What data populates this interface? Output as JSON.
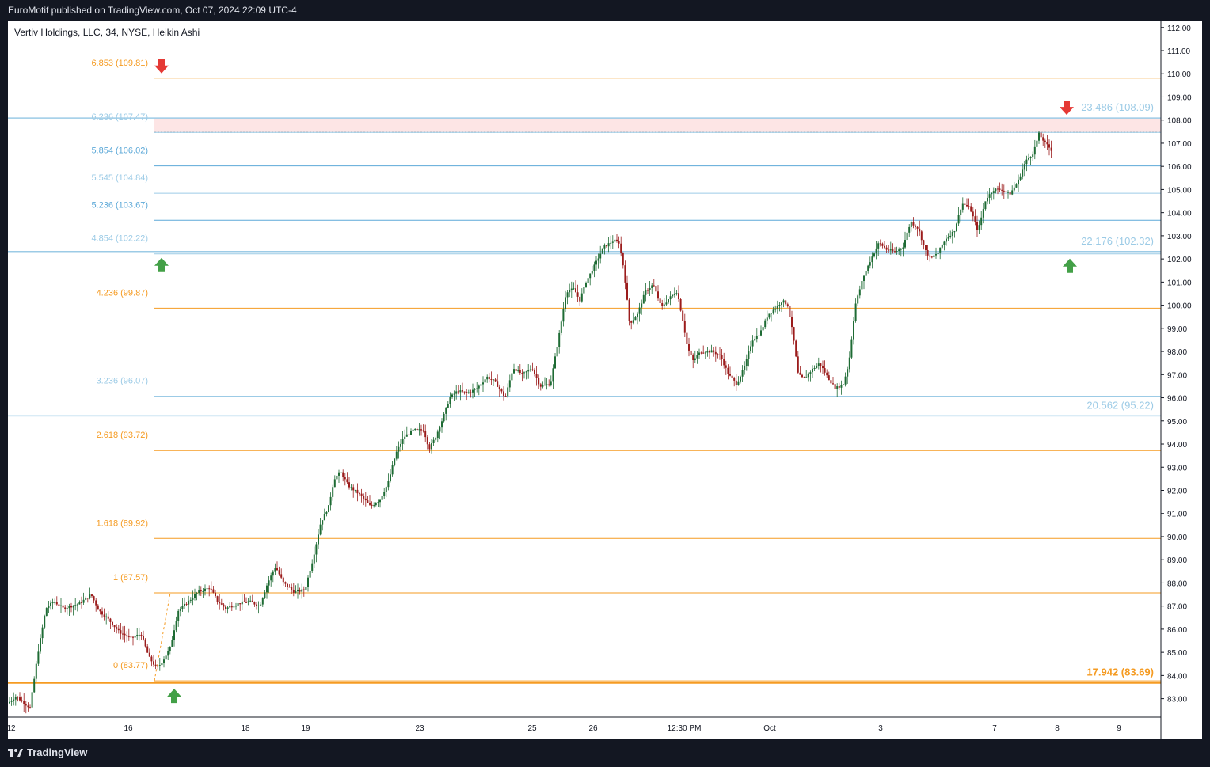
{
  "header": {
    "published_by": "EuroMotif published on TradingView.com, Oct 07, 2024 22:09 UTC-4"
  },
  "footer": {
    "brand": "TradingView"
  },
  "colors": {
    "background": "#ffffff",
    "frame": "#131722",
    "up_candle": "#1e6b34",
    "down_candle": "#9b1c1c",
    "fib_orange": "#f59b22",
    "fib_blue": "#5da9d8",
    "fib_blue_light": "#9ccbe6",
    "arrow_red": "#e53935",
    "arrow_green": "#43a047",
    "zone_fill": "#fde5e5"
  },
  "chart_data": {
    "type": "candlestick",
    "title": "Vertiv Holdings, LLC, 34, NYSE, Heikin Ashi",
    "ylim": [
      82.2,
      112.3
    ],
    "grid": false,
    "y_ticks": [
      "83.00",
      "84.00",
      "85.00",
      "86.00",
      "87.00",
      "88.00",
      "89.00",
      "90.00",
      "91.00",
      "92.00",
      "93.00",
      "94.00",
      "95.00",
      "96.00",
      "97.00",
      "98.00",
      "99.00",
      "100.00",
      "101.00",
      "102.00",
      "103.00",
      "104.00",
      "105.00",
      "106.00",
      "107.00",
      "108.00",
      "109.00",
      "110.00",
      "111.00",
      "112.00"
    ],
    "x_ticks": [
      "12",
      "16",
      "18",
      "19",
      "23",
      "25",
      "26",
      "12:30 PM",
      "Oct",
      "3",
      "7",
      "8",
      "9"
    ],
    "left_fib_levels": [
      {
        "label": "0 (83.77)",
        "value": 83.77,
        "color": "orange"
      },
      {
        "label": "1 (87.57)",
        "value": 87.57,
        "color": "orange"
      },
      {
        "label": "1.618 (89.92)",
        "value": 89.92,
        "color": "orange"
      },
      {
        "label": "2.618 (93.72)",
        "value": 93.72,
        "color": "orange"
      },
      {
        "label": "3.236 (96.07)",
        "value": 96.07,
        "color": "lightblue"
      },
      {
        "label": "4.236 (99.87)",
        "value": 99.87,
        "color": "orange"
      },
      {
        "label": "4.854 (102.22)",
        "value": 102.22,
        "color": "lightblue"
      },
      {
        "label": "5.236 (103.67)",
        "value": 103.67,
        "color": "blue"
      },
      {
        "label": "5.545 (104.84)",
        "value": 104.84,
        "color": "lightblue"
      },
      {
        "label": "5.854 (106.02)",
        "value": 106.02,
        "color": "blue"
      },
      {
        "label": "6.236 (107.47)",
        "value": 107.47,
        "color": "lightblue"
      },
      {
        "label": "6.853 (109.81)",
        "value": 109.81,
        "color": "orange"
      }
    ],
    "right_fib_levels": [
      {
        "label": "17.942 (83.69)",
        "value": 83.69,
        "color": "orange"
      },
      {
        "label": "20.562 (95.22)",
        "value": 95.22,
        "color": "lightblue"
      },
      {
        "label": "22.176 (102.32)",
        "value": 102.32,
        "color": "lightblue"
      },
      {
        "label": "23.486 (108.09)",
        "value": 108.09,
        "color": "lightblue"
      }
    ],
    "resistance_zone": [
      107.47,
      108.09
    ],
    "arrows": [
      {
        "direction": "down",
        "value": 109.81,
        "color": "red"
      },
      {
        "direction": "up",
        "value": 102.22,
        "color": "green"
      },
      {
        "direction": "up",
        "value": 83.77,
        "color": "green"
      },
      {
        "direction": "down",
        "value": 108.09,
        "color": "red"
      },
      {
        "direction": "up",
        "value": 102.32,
        "color": "green"
      }
    ],
    "price_path": [
      [
        0,
        82.8
      ],
      [
        10,
        83.1
      ],
      [
        28,
        82.6
      ],
      [
        38,
        85.0
      ],
      [
        48,
        86.9
      ],
      [
        58,
        87.2
      ],
      [
        70,
        86.9
      ],
      [
        90,
        87.1
      ],
      [
        105,
        87.5
      ],
      [
        115,
        86.8
      ],
      [
        125,
        86.5
      ],
      [
        140,
        85.9
      ],
      [
        155,
        85.6
      ],
      [
        168,
        85.8
      ],
      [
        178,
        84.8
      ],
      [
        188,
        84.3
      ],
      [
        195,
        84.6
      ],
      [
        205,
        85.2
      ],
      [
        215,
        86.8
      ],
      [
        225,
        87.1
      ],
      [
        240,
        87.6
      ],
      [
        255,
        87.8
      ],
      [
        265,
        87.2
      ],
      [
        275,
        86.9
      ],
      [
        290,
        87.1
      ],
      [
        305,
        87.2
      ],
      [
        318,
        87.0
      ],
      [
        328,
        88.0
      ],
      [
        338,
        88.7
      ],
      [
        348,
        88.0
      ],
      [
        362,
        87.6
      ],
      [
        375,
        87.7
      ],
      [
        385,
        89.0
      ],
      [
        395,
        90.6
      ],
      [
        405,
        91.3
      ],
      [
        412,
        92.5
      ],
      [
        420,
        92.8
      ],
      [
        430,
        92.2
      ],
      [
        445,
        91.8
      ],
      [
        458,
        91.3
      ],
      [
        470,
        91.6
      ],
      [
        480,
        92.3
      ],
      [
        490,
        93.6
      ],
      [
        500,
        94.3
      ],
      [
        512,
        94.6
      ],
      [
        525,
        94.6
      ],
      [
        532,
        93.8
      ],
      [
        540,
        94.3
      ],
      [
        548,
        95.0
      ],
      [
        558,
        96.0
      ],
      [
        568,
        96.3
      ],
      [
        580,
        96.2
      ],
      [
        592,
        96.4
      ],
      [
        605,
        96.9
      ],
      [
        615,
        96.7
      ],
      [
        628,
        96.0
      ],
      [
        638,
        97.3
      ],
      [
        650,
        97.0
      ],
      [
        662,
        97.3
      ],
      [
        672,
        96.5
      ],
      [
        685,
        96.6
      ],
      [
        695,
        98.5
      ],
      [
        705,
        100.6
      ],
      [
        715,
        100.7
      ],
      [
        722,
        100.2
      ],
      [
        730,
        101.0
      ],
      [
        742,
        101.8
      ],
      [
        752,
        102.5
      ],
      [
        765,
        102.8
      ],
      [
        772,
        102.7
      ],
      [
        778,
        101.5
      ],
      [
        785,
        99.2
      ],
      [
        795,
        99.6
      ],
      [
        805,
        100.6
      ],
      [
        815,
        100.9
      ],
      [
        825,
        99.9
      ],
      [
        835,
        100.3
      ],
      [
        845,
        100.6
      ],
      [
        852,
        99.4
      ],
      [
        858,
        98.2
      ],
      [
        865,
        97.6
      ],
      [
        875,
        98.0
      ],
      [
        890,
        98.0
      ],
      [
        900,
        97.8
      ],
      [
        910,
        97.0
      ],
      [
        920,
        96.6
      ],
      [
        930,
        97.3
      ],
      [
        940,
        98.5
      ],
      [
        950,
        98.8
      ],
      [
        960,
        99.6
      ],
      [
        970,
        99.9
      ],
      [
        978,
        100.2
      ],
      [
        985,
        100.0
      ],
      [
        992,
        98.6
      ],
      [
        998,
        97.0
      ],
      [
        1005,
        96.8
      ],
      [
        1015,
        97.2
      ],
      [
        1025,
        97.5
      ],
      [
        1035,
        96.9
      ],
      [
        1045,
        96.4
      ],
      [
        1055,
        96.6
      ],
      [
        1062,
        97.5
      ],
      [
        1070,
        100.0
      ],
      [
        1080,
        101.2
      ],
      [
        1090,
        102.0
      ],
      [
        1100,
        102.7
      ],
      [
        1110,
        102.4
      ],
      [
        1120,
        102.3
      ],
      [
        1130,
        102.5
      ],
      [
        1140,
        103.6
      ],
      [
        1150,
        103.3
      ],
      [
        1158,
        102.4
      ],
      [
        1165,
        102.0
      ],
      [
        1175,
        102.3
      ],
      [
        1185,
        102.9
      ],
      [
        1195,
        103.2
      ],
      [
        1205,
        104.4
      ],
      [
        1215,
        104.2
      ],
      [
        1225,
        103.2
      ],
      [
        1235,
        104.6
      ],
      [
        1245,
        105.0
      ],
      [
        1255,
        105.0
      ],
      [
        1265,
        104.8
      ],
      [
        1275,
        105.3
      ],
      [
        1285,
        106.2
      ],
      [
        1295,
        106.6
      ],
      [
        1302,
        107.4
      ],
      [
        1310,
        107.0
      ],
      [
        1318,
        106.7
      ],
      [
        1326,
        106.6
      ]
    ]
  }
}
